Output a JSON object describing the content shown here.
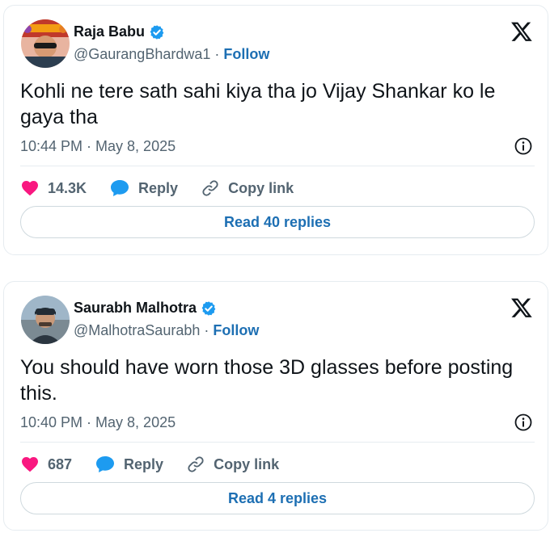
{
  "tweets": [
    {
      "author": {
        "name": "Raja Babu",
        "handle": "@GaurangBhardwa1",
        "separator": "·",
        "follow_label": "Follow",
        "verified": true
      },
      "text": "Kohli ne tere sath sahi kiya tha jo Vijay Shankar ko le gaya tha",
      "timestamp": "10:44 PM · May 8, 2025",
      "likes": "14.3K",
      "reply_label": "Reply",
      "copy_link_label": "Copy link",
      "read_replies_label": "Read 40 replies"
    },
    {
      "author": {
        "name": "Saurabh Malhotra",
        "handle": "@MalhotraSaurabh",
        "separator": "·",
        "follow_label": "Follow",
        "verified": true
      },
      "text": "You should have worn those 3D glasses before posting this.",
      "timestamp": "10:40 PM · May 8, 2025",
      "likes": "687",
      "reply_label": "Reply",
      "copy_link_label": "Copy link",
      "read_replies_label": "Read 4 replies"
    }
  ],
  "icons": {
    "verified": "verified-badge-icon",
    "x_logo": "x-logo-icon",
    "info": "info-icon",
    "like": "heart-icon",
    "reply": "reply-bubble-icon",
    "copy_link": "link-icon"
  },
  "colors": {
    "like": "#f91880",
    "reply": "#1d9bf0",
    "follow": "#1d6fb3",
    "verified": "#1d9bf0",
    "muted": "#536471"
  }
}
